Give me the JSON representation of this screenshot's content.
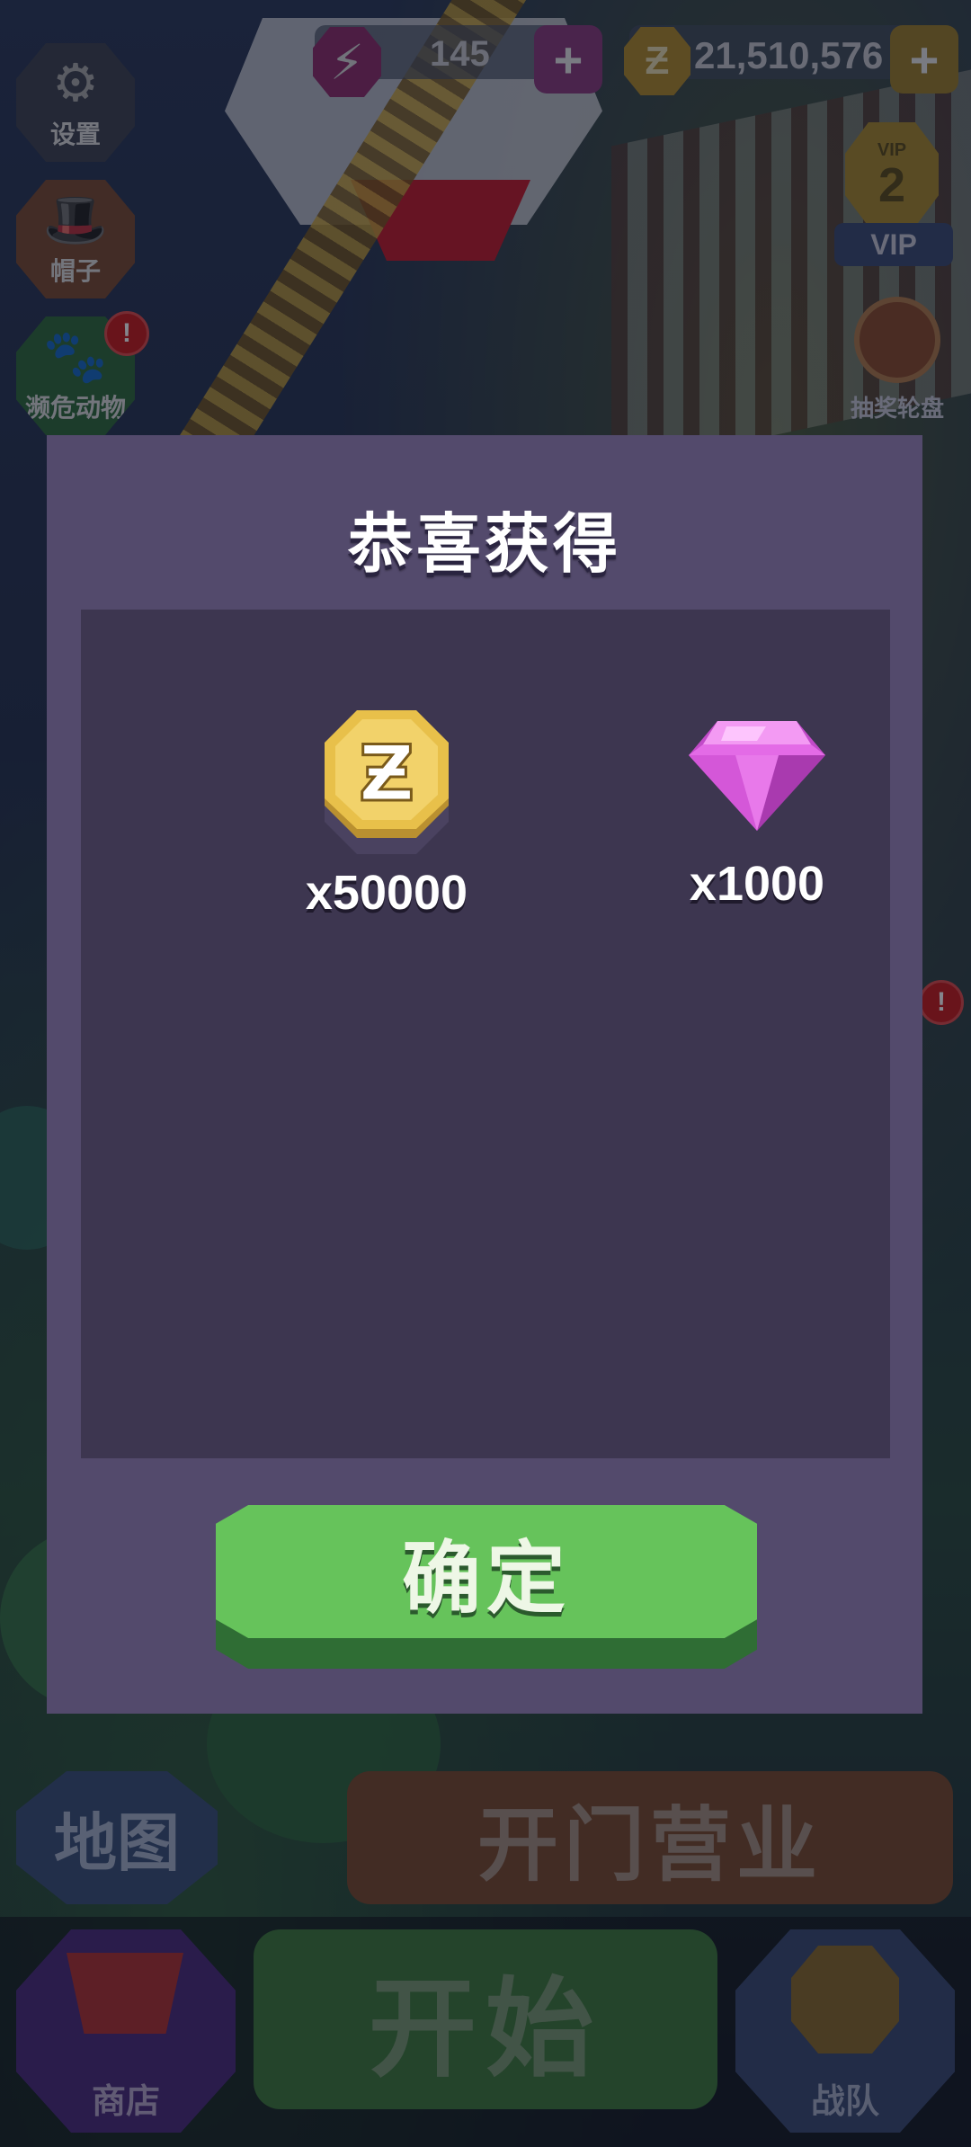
{
  "hud": {
    "energy": "145",
    "coins": "21,510,576",
    "vip_label": "VIP",
    "vip_level": "2",
    "vip_badge_text": "VIP"
  },
  "left_menu": {
    "settings": "设置",
    "hats": "帽子",
    "animals": "濒危动物",
    "alert": "!"
  },
  "right_menu": {
    "lottery": "抽奖轮盘",
    "alert": "!"
  },
  "dialog": {
    "title": "恭喜获得",
    "rewards": [
      {
        "icon": "coin-icon",
        "amount": "x50000"
      },
      {
        "icon": "gem-icon",
        "amount": "x1000"
      }
    ],
    "confirm_label": "确定"
  },
  "bottom": {
    "map": "地图",
    "open_business": "开门营业",
    "shop": "商店",
    "start": "开始",
    "team": "战队"
  },
  "colors": {
    "dialog_bg": "#534a6c",
    "panel_bg": "#3d3650",
    "confirm_green": "#66c35b",
    "coin_gold": "#e8c04a",
    "gem_pink": "#e36be6"
  }
}
